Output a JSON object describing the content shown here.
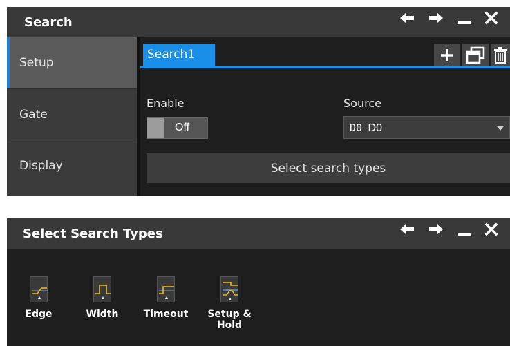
{
  "search_panel": {
    "title": "Search",
    "nav": [
      {
        "label": "Setup",
        "active": true
      },
      {
        "label": "Gate",
        "active": false
      },
      {
        "label": "Display",
        "active": false
      }
    ],
    "tab": {
      "label": "Search1"
    },
    "enable": {
      "label": "Enable",
      "value": "Off"
    },
    "source": {
      "label": "Source",
      "prefix": "D0",
      "value": "D0"
    },
    "select_types_button": "Select search types"
  },
  "types_panel": {
    "title": "Select Search Types",
    "types": [
      {
        "label": "Edge",
        "icon": "edge-icon"
      },
      {
        "label": "Width",
        "icon": "width-icon"
      },
      {
        "label": "Timeout",
        "icon": "timeout-icon"
      },
      {
        "label": "Setup &\nHold",
        "icon": "setup-hold-icon"
      }
    ]
  },
  "colors": {
    "accent": "#1a8fe8",
    "titlebar": "#393939",
    "signal": "#f0c020"
  }
}
